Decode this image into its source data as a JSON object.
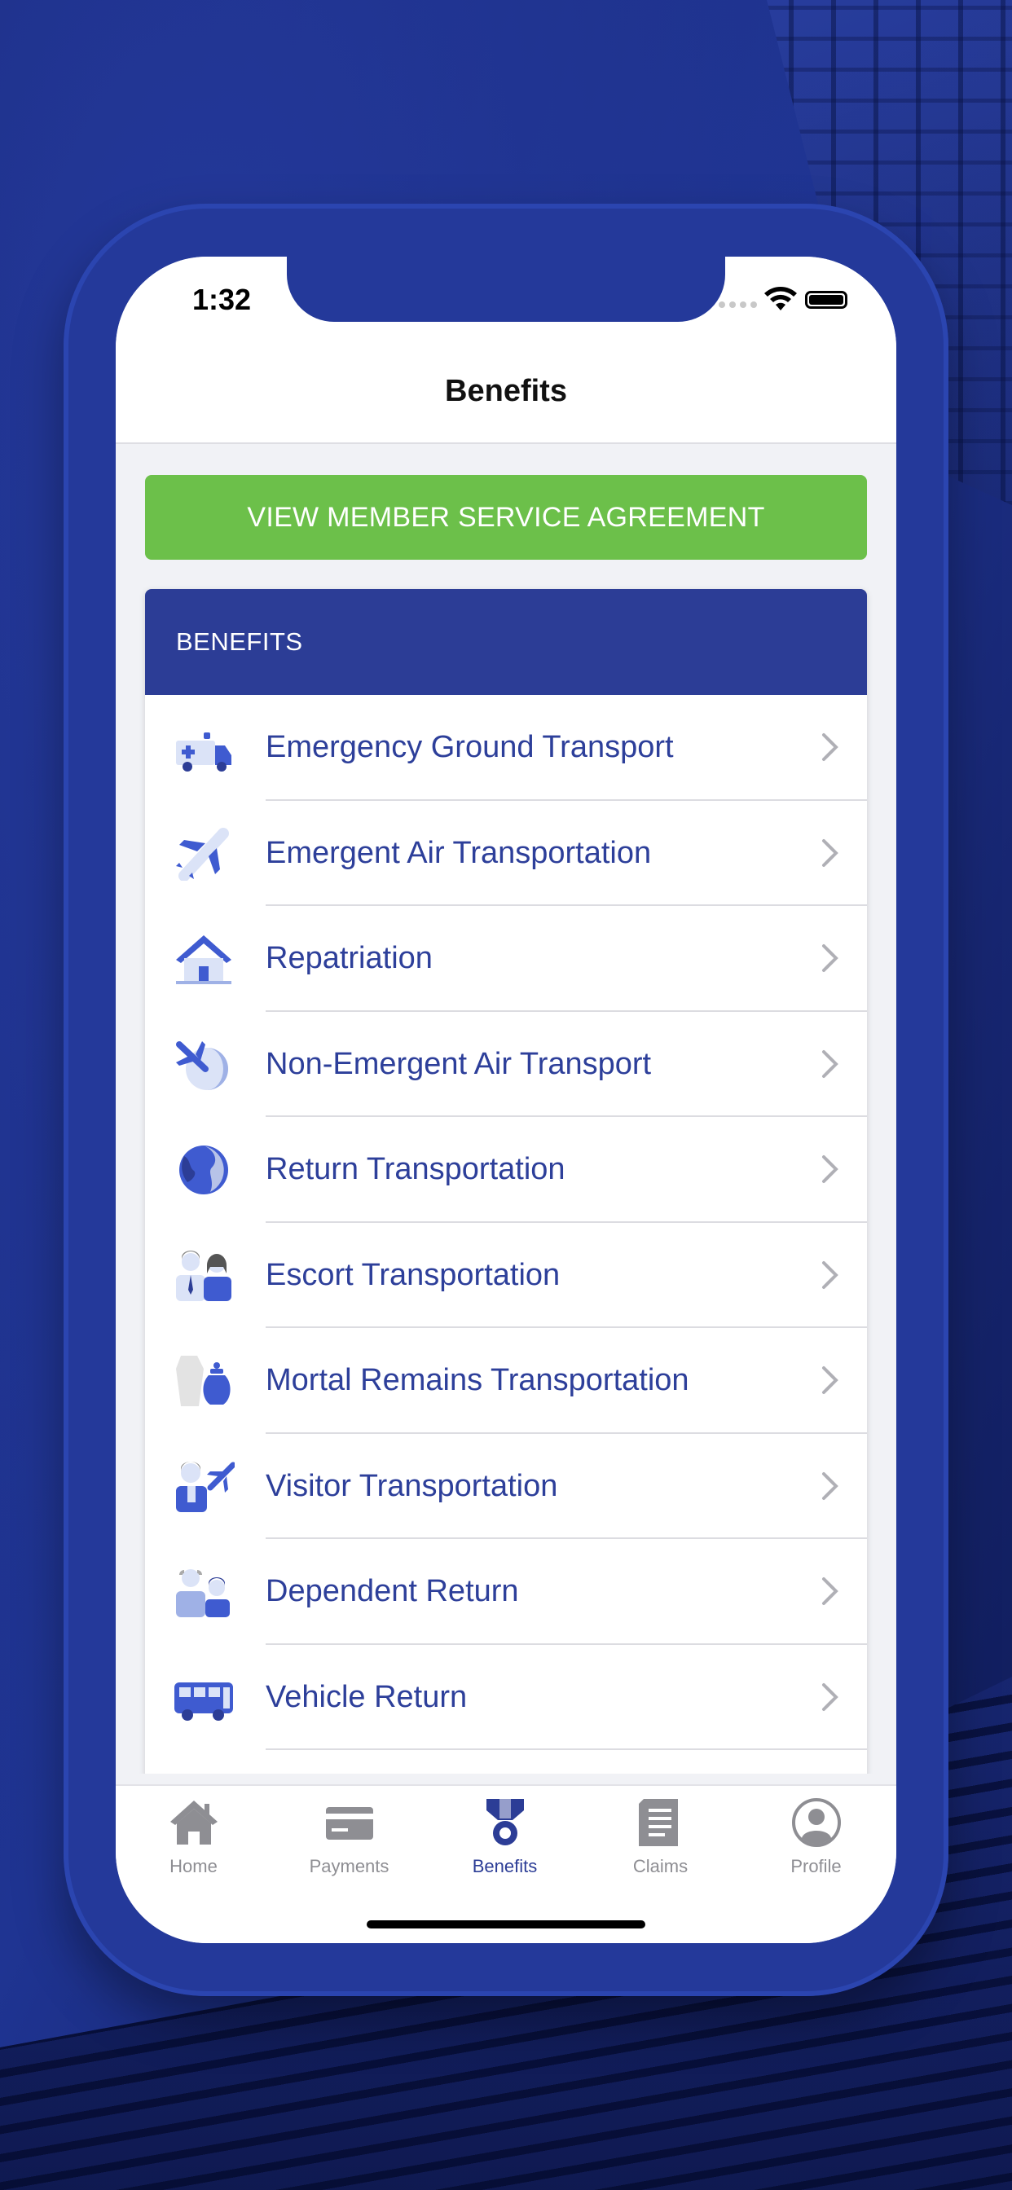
{
  "status_bar": {
    "time": "1:32"
  },
  "nav": {
    "title": "Benefits"
  },
  "msa_button": {
    "label": "VIEW MEMBER SERVICE AGREEMENT"
  },
  "benefits": {
    "header": "BENEFITS",
    "items": [
      {
        "label": "Emergency Ground Transport",
        "icon": "ambulance-icon"
      },
      {
        "label": "Emergent Air Transportation",
        "icon": "airplane-icon"
      },
      {
        "label": "Repatriation",
        "icon": "house-icon"
      },
      {
        "label": "Non-Emergent Air Transport",
        "icon": "globe-airplane-icon"
      },
      {
        "label": "Return Transportation",
        "icon": "globe-icon"
      },
      {
        "label": "Escort Transportation",
        "icon": "couple-icon"
      },
      {
        "label": "Mortal Remains Transportation",
        "icon": "coffin-urn-icon"
      },
      {
        "label": "Visitor Transportation",
        "icon": "visitor-airplane-icon"
      },
      {
        "label": "Dependent Return",
        "icon": "elderly-dependent-icon"
      },
      {
        "label": "Vehicle Return",
        "icon": "vehicle-icon"
      }
    ]
  },
  "tabs": [
    {
      "label": "Home",
      "icon": "home-icon",
      "active": false
    },
    {
      "label": "Payments",
      "icon": "credit-card-icon",
      "active": false
    },
    {
      "label": "Benefits",
      "icon": "medal-icon",
      "active": true
    },
    {
      "label": "Claims",
      "icon": "document-icon",
      "active": false
    },
    {
      "label": "Profile",
      "icon": "profile-icon",
      "active": false
    }
  ],
  "colors": {
    "brand_blue": "#2c3d96",
    "accent_green": "#6cc04a",
    "text_blue": "#2d3f9a",
    "inactive_gray": "#8e8e93"
  }
}
